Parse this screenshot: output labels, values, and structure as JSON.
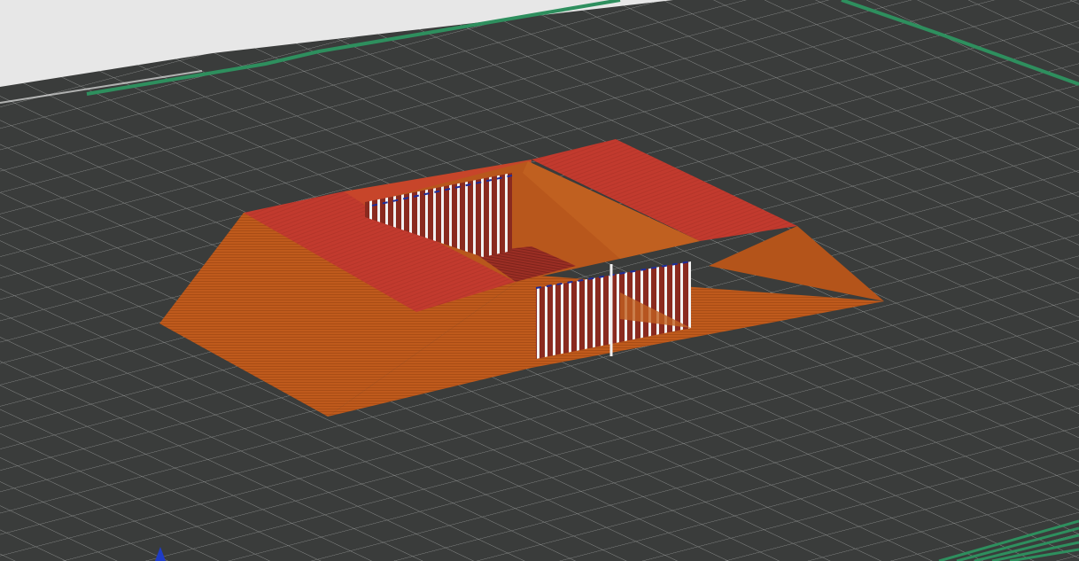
{
  "app": {
    "view": "3d-slice-preview"
  },
  "viewport": {
    "background_color": "#e7e7e7",
    "bed_color": "#3a3c3b",
    "grid_color": "#8c8e8d",
    "bed_border_color": "#2e8f5e",
    "bed_edge_highlight": "#ffffff"
  },
  "model": {
    "name": "",
    "perimeter_color": "#bf5a1c",
    "top_surface_color": "#c23a2e",
    "bridge_color": "#9b2e24",
    "wipe_color": "#f1f1f1",
    "travel_color": "#1d2d9a"
  },
  "axis_gizmo": {
    "z_color": "#1f3cc6"
  }
}
